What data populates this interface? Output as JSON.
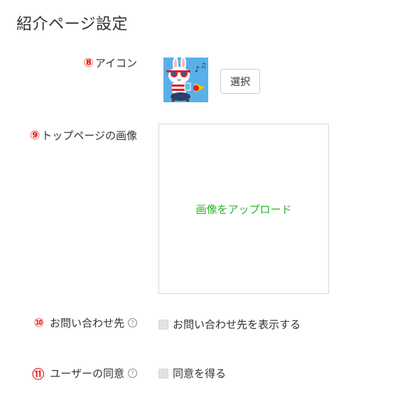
{
  "page_title": "紹介ページ設定",
  "rows": {
    "icon": {
      "number": "⑧",
      "label": "アイコン",
      "button_label": "選択"
    },
    "top_image": {
      "number": "⑨",
      "label": "トップページの画像",
      "upload_label": "画像をアップロード"
    },
    "contact": {
      "number": "⑩",
      "label": "お問い合わせ先",
      "help": "?",
      "checkbox_label": "お問い合わせ先を表示する",
      "checked": false
    },
    "consent": {
      "number": "⑪",
      "label": "ユーザーの同意",
      "help": "?",
      "checkbox_label": "同意を得る",
      "checked": false
    }
  },
  "colors": {
    "number_red": "#e0241b",
    "upload_green": "#2ab52a",
    "avatar_bg": "#59b0e8"
  },
  "icons": {
    "avatar": "rabbit-character-avatar",
    "help": "question-circle-icon"
  }
}
